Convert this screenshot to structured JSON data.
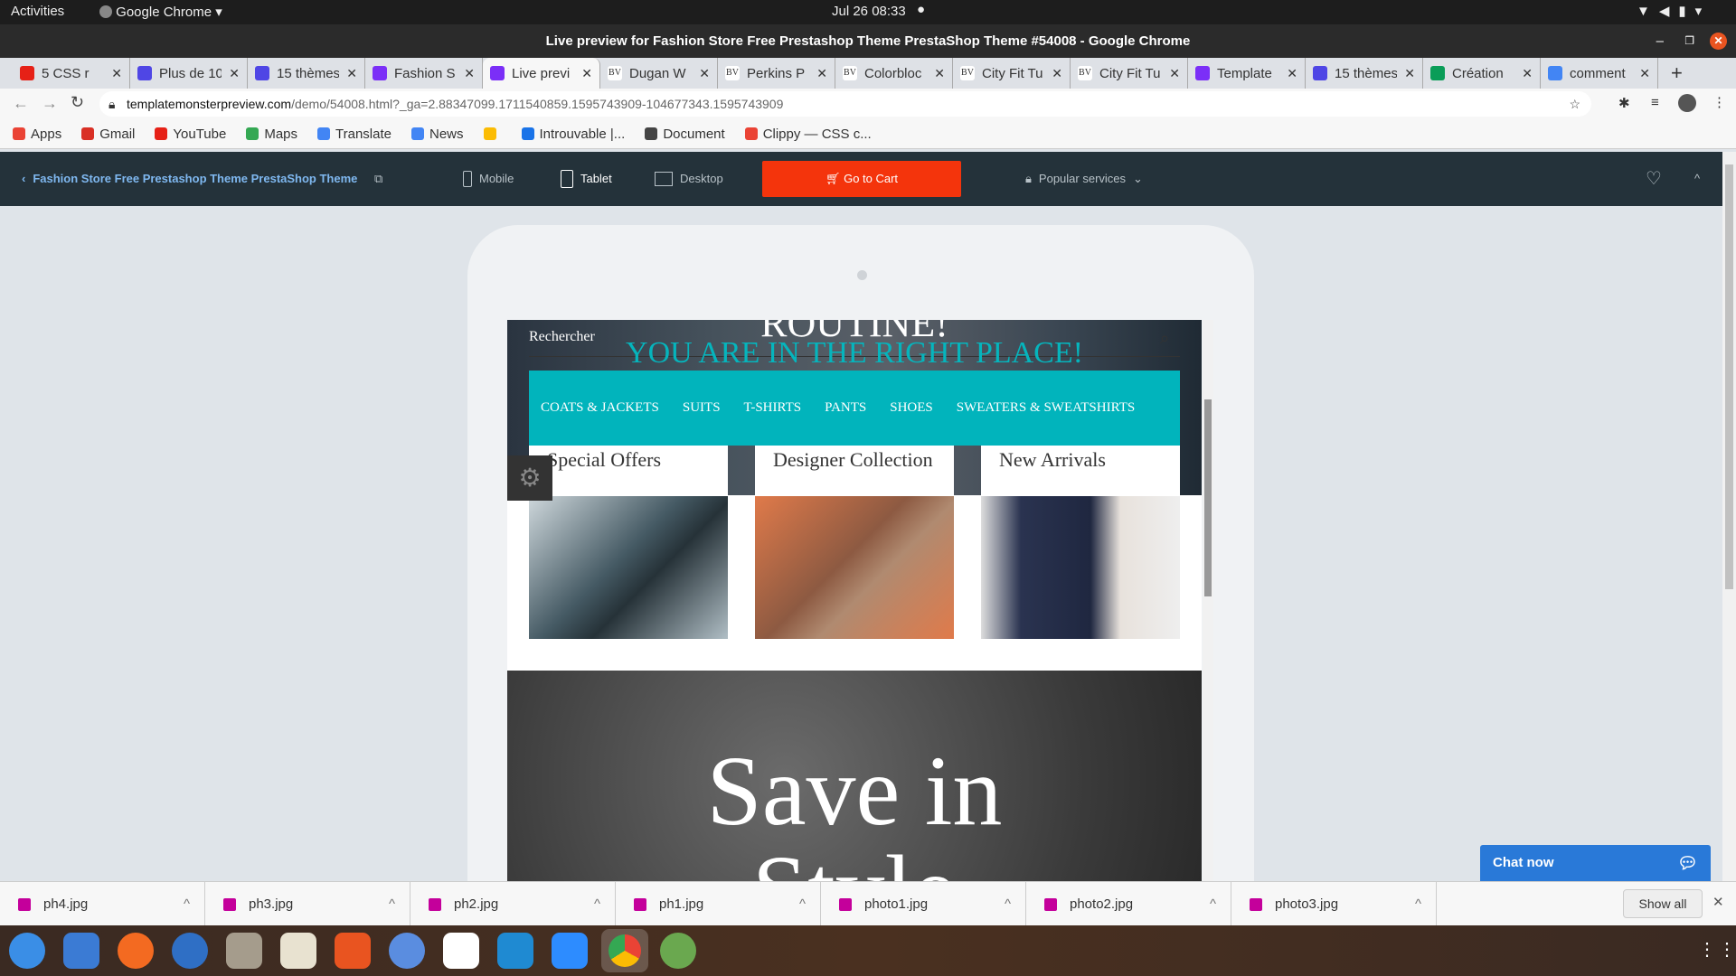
{
  "system": {
    "activities": "Activities",
    "app": "Google Chrome",
    "clock": "Jul 26  08:33"
  },
  "window": {
    "title": "Live preview for Fashion Store Free Prestashop Theme PrestaShop Theme #54008 - Google Chrome"
  },
  "tabs": [
    {
      "label": "5 CSS r",
      "color": "#e62117",
      "icon": "youtube-icon"
    },
    {
      "label": "Plus de 10",
      "color": "#4f46e5",
      "icon": "c-icon"
    },
    {
      "label": "15 thèmes",
      "color": "#4f46e5",
      "icon": "c-icon"
    },
    {
      "label": "Fashion S",
      "color": "#7b2ff7",
      "icon": "templatemonster-icon"
    },
    {
      "label": "Live previ",
      "color": "#7b2ff7",
      "icon": "templatemonster-icon",
      "active": true
    },
    {
      "label": "Dugan W",
      "color": "#ffffff",
      "icon": "bv-icon"
    },
    {
      "label": "Perkins P",
      "color": "#ffffff",
      "icon": "bv-icon"
    },
    {
      "label": "Colorbloc",
      "color": "#ffffff",
      "icon": "bv-icon"
    },
    {
      "label": "City Fit Tu",
      "color": "#ffffff",
      "icon": "bv-icon"
    },
    {
      "label": "City Fit Tu",
      "color": "#ffffff",
      "icon": "bv-icon"
    },
    {
      "label": "Template",
      "color": "#7b2ff7",
      "icon": "templatemonster-icon"
    },
    {
      "label": "15 thèmes",
      "color": "#4f46e5",
      "icon": "c-icon"
    },
    {
      "label": "Création",
      "color": "#0a9d58",
      "icon": "globe-icon"
    },
    {
      "label": "comment",
      "color": "#4285f4",
      "icon": "google-icon"
    }
  ],
  "address": {
    "host": "templatemonsterpreview.com",
    "path": "/demo/54008.html?_ga=2.88347099.1711540859.1595743909-104677343.1595743909"
  },
  "bookmarks": [
    {
      "label": "Apps",
      "color": "#ea4335"
    },
    {
      "label": "Gmail",
      "color": "#d93025"
    },
    {
      "label": "YouTube",
      "color": "#e62117"
    },
    {
      "label": "Maps",
      "color": "#34a853"
    },
    {
      "label": "Translate",
      "color": "#4285f4"
    },
    {
      "label": "News",
      "color": "#4285f4"
    },
    {
      "label": "",
      "color": "#fbbc04"
    },
    {
      "label": "Introuvable |...",
      "color": "#1a73e8"
    },
    {
      "label": "Document",
      "color": "#444444"
    },
    {
      "label": "Clippy — CSS c...",
      "color": "#ea4335"
    }
  ],
  "preview_toolbar": {
    "back_title": "Fashion Store Free Prestashop Theme PrestaShop Theme",
    "mobile": "Mobile",
    "tablet": "Tablet",
    "desktop": "Desktop",
    "cart": "Go to Cart",
    "services": "Popular services"
  },
  "site": {
    "search": "Rechercher",
    "slogan_top": "ROUTINE!",
    "slogan": "YOU ARE IN THE RIGHT PLACE!",
    "nav": [
      "COATS & JACKETS",
      "SUITS",
      "T-SHIRTS",
      "PANTS",
      "SHOES",
      "SWEATERS & SWEATSHIRTS"
    ],
    "cards": [
      "Special Offers",
      "Designer Collection",
      "New Arrivals"
    ],
    "banner": "Save in",
    "banner2": "Style"
  },
  "chat": "Chat now",
  "downloads": [
    "ph4.jpg",
    "ph3.jpg",
    "ph2.jpg",
    "ph1.jpg",
    "photo1.jpg",
    "photo2.jpg",
    "photo3.jpg"
  ],
  "show_all": "Show all",
  "colors": {
    "accent": "#01b4bc",
    "cart": "#f4340c",
    "toolbar": "#24323a"
  }
}
